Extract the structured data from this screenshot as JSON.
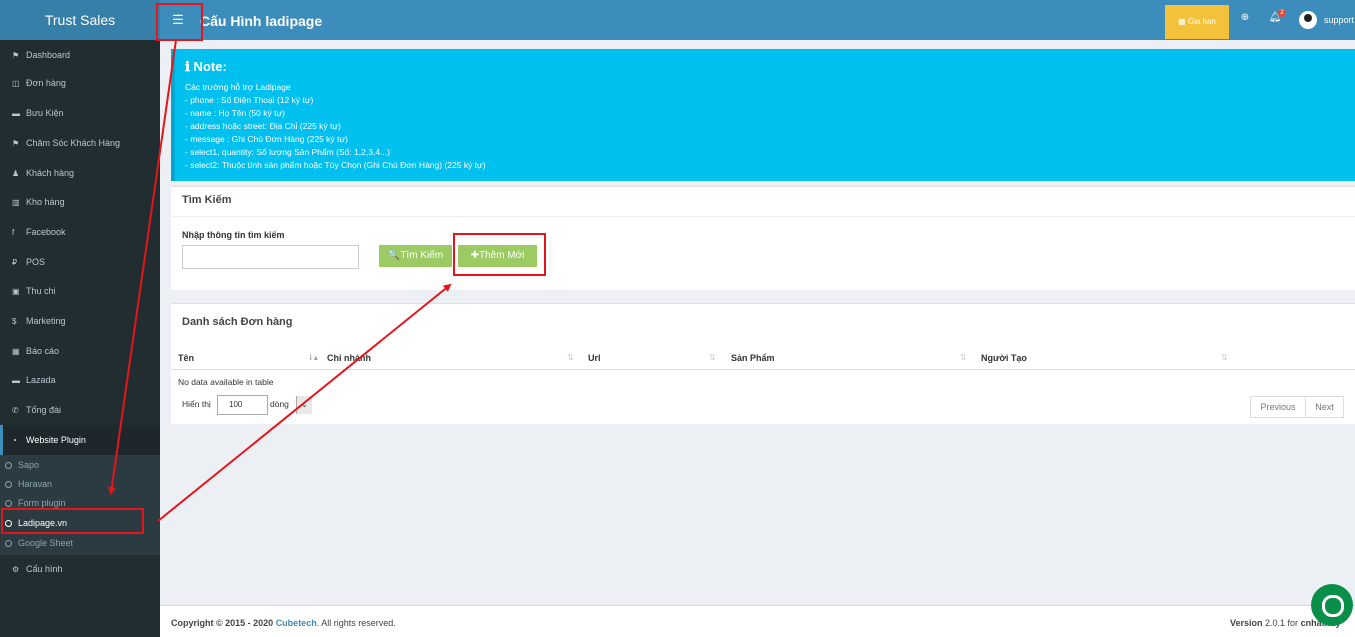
{
  "header": {
    "brand": "Trust Sales",
    "menu_icon": "☰",
    "page_title": "Cấu Hình ladipage",
    "renew_label": "Gia hạn",
    "notif_count": "2",
    "user": "support"
  },
  "sidebar": {
    "items": [
      {
        "icon": "⚑",
        "label": "Dashboard"
      },
      {
        "icon": "◫",
        "label": "Đơn hàng"
      },
      {
        "icon": "▬",
        "label": "Bưu Kiện"
      },
      {
        "icon": "⚑",
        "label": "Chăm Sóc Khách Hàng"
      },
      {
        "icon": "♟",
        "label": "Khách hàng"
      },
      {
        "icon": "▥",
        "label": "Kho hàng"
      },
      {
        "icon": "f",
        "label": "Facebook"
      },
      {
        "icon": "₽",
        "label": "POS"
      },
      {
        "icon": "▣",
        "label": "Thu chi"
      },
      {
        "icon": "$",
        "label": "Marketing"
      },
      {
        "icon": "▦",
        "label": "Báo cáo"
      },
      {
        "icon": "▬",
        "label": "Lazada"
      },
      {
        "icon": "✆",
        "label": "Tổng đài"
      },
      {
        "icon": "◔",
        "label": "Website Plugin"
      }
    ],
    "sub_items": [
      "Sapo",
      "Haravan",
      "Form plugin",
      "Ladipage.vn",
      "Google Sheet"
    ],
    "config": {
      "icon": "⚙",
      "label": "Cấu hình"
    }
  },
  "note": {
    "title": "ℹ Note:",
    "lines": [
      "Các trường hỗ trợ Ladipage",
      "- phone : Số Điện Thoại (12 ký tự)",
      "- name : Họ Tên (50 ký tự)",
      "- address hoặc street: Địa Chỉ (225 ký tự)",
      "- message : Ghi Chú Đơn Hàng (225 ký tự)",
      "- select1, quantity: Số lượng Sản Phẩm (Số: 1,2,3,4...)",
      "- select2: Thuộc tính sản phẩm hoặc Tùy Chọn (Ghi Chú Đơn Hàng) (225 ký tự)"
    ]
  },
  "search": {
    "heading": "Tìm Kiếm",
    "label": "Nhập thông tin tìm kiếm",
    "value": "",
    "search_button": "🔍Tìm Kiếm",
    "add_button": "✚Thêm Mới"
  },
  "list": {
    "heading": "Danh sách Đơn hàng",
    "columns": [
      "Tên",
      "Chi nhánh",
      "Url",
      "Sản Phẩm",
      "Người Tạo"
    ],
    "empty_text": "No data available in table",
    "length_prefix": "Hiển thị",
    "length_value": "100",
    "length_suffix": "dòng",
    "prev": "Previous",
    "next": "Next"
  },
  "footer": {
    "copyright_prefix": "Copyright © 2015 - 2020",
    "company": "Cubetech",
    "rights": ". All rights reserved.",
    "version_label": "Version",
    "version": "2.0.1 for",
    "tenant": "cnhathuy"
  },
  "colors": {
    "topbar": "#3c8dbc",
    "sidebar": "#222d32",
    "note": "#00c0ef",
    "accent_button": "#8bc34a",
    "annotation": "#e4161b"
  }
}
